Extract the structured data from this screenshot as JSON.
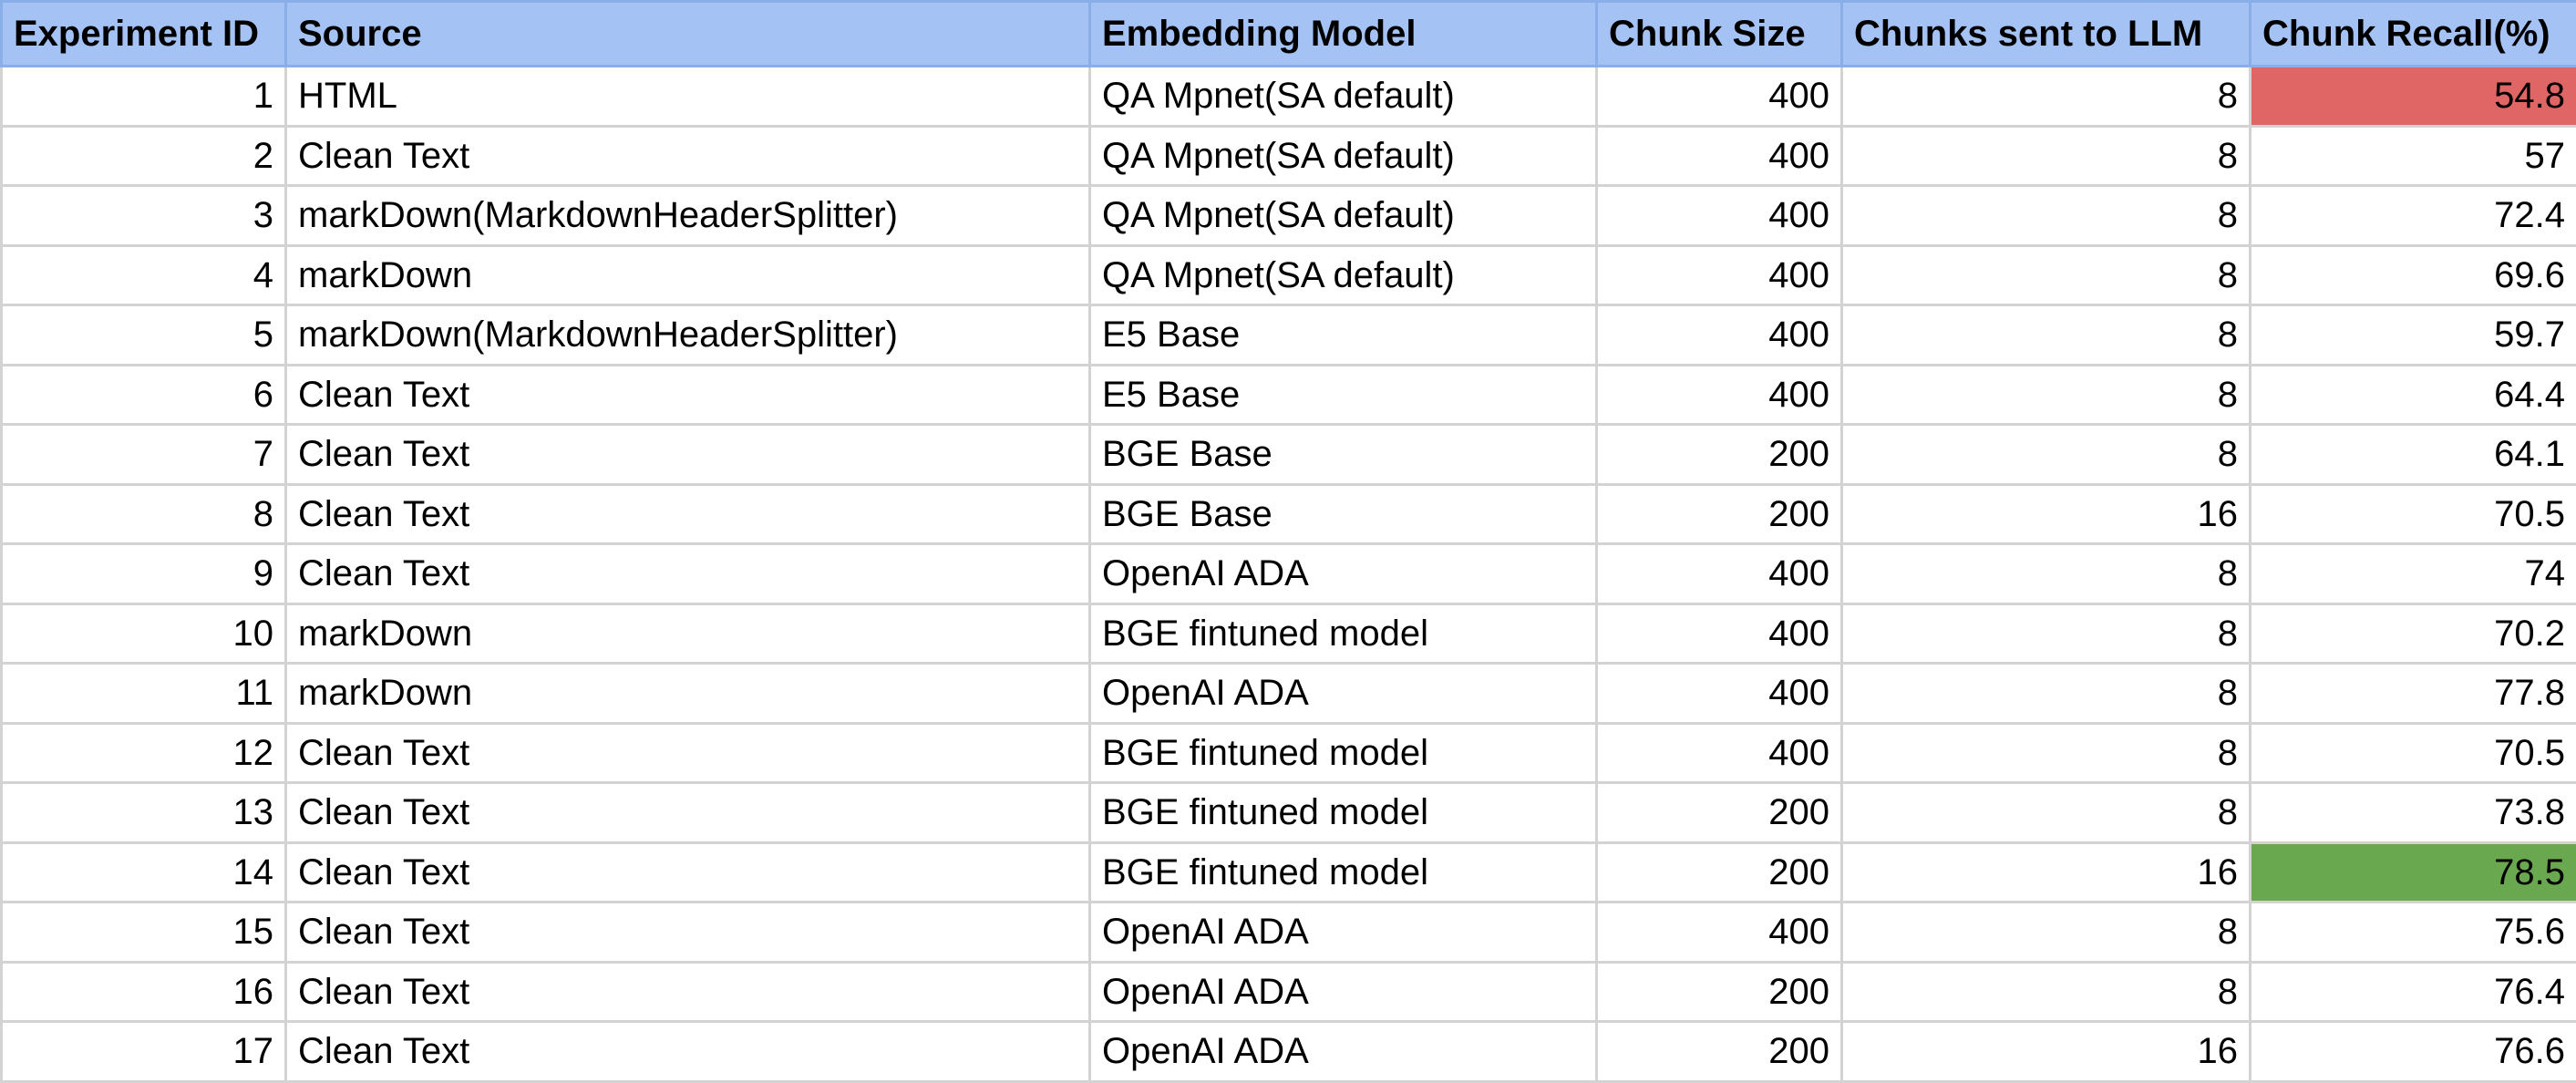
{
  "columns": [
    "Experiment ID",
    "Source",
    "Embedding Model",
    "Chunk Size",
    "Chunks sent to LLM",
    "Chunk Recall(%)"
  ],
  "rows": [
    {
      "id": "1",
      "source": "HTML",
      "model": "QA Mpnet(SA default)",
      "chunk_size": "400",
      "chunks_sent": "8",
      "recall": "54.8",
      "highlight": "low"
    },
    {
      "id": "2",
      "source": "Clean Text",
      "model": "QA Mpnet(SA default)",
      "chunk_size": "400",
      "chunks_sent": "8",
      "recall": "57"
    },
    {
      "id": "3",
      "source": "markDown(MarkdownHeaderSplitter)",
      "model": "QA Mpnet(SA default)",
      "chunk_size": "400",
      "chunks_sent": "8",
      "recall": "72.4"
    },
    {
      "id": "4",
      "source": "markDown",
      "model": "QA Mpnet(SA default)",
      "chunk_size": "400",
      "chunks_sent": "8",
      "recall": "69.6"
    },
    {
      "id": "5",
      "source": "markDown(MarkdownHeaderSplitter)",
      "model": "E5 Base",
      "chunk_size": "400",
      "chunks_sent": "8",
      "recall": "59.7"
    },
    {
      "id": "6",
      "source": "Clean Text",
      "model": "E5 Base",
      "chunk_size": "400",
      "chunks_sent": "8",
      "recall": "64.4"
    },
    {
      "id": "7",
      "source": "Clean Text",
      "model": "BGE Base",
      "chunk_size": "200",
      "chunks_sent": "8",
      "recall": "64.1"
    },
    {
      "id": "8",
      "source": "Clean Text",
      "model": "BGE Base",
      "chunk_size": "200",
      "chunks_sent": "16",
      "recall": "70.5"
    },
    {
      "id": "9",
      "source": "Clean Text",
      "model": "OpenAI ADA",
      "chunk_size": "400",
      "chunks_sent": "8",
      "recall": "74"
    },
    {
      "id": "10",
      "source": "markDown",
      "model": "BGE fintuned model",
      "chunk_size": "400",
      "chunks_sent": "8",
      "recall": "70.2"
    },
    {
      "id": "11",
      "source": "markDown",
      "model": "OpenAI ADA",
      "chunk_size": "400",
      "chunks_sent": "8",
      "recall": "77.8"
    },
    {
      "id": "12",
      "source": "Clean Text",
      "model": "BGE fintuned model",
      "chunk_size": "400",
      "chunks_sent": "8",
      "recall": "70.5"
    },
    {
      "id": "13",
      "source": "Clean Text",
      "model": "BGE fintuned model",
      "chunk_size": "200",
      "chunks_sent": "8",
      "recall": "73.8"
    },
    {
      "id": "14",
      "source": "Clean Text",
      "model": "BGE fintuned model",
      "chunk_size": "200",
      "chunks_sent": "16",
      "recall": "78.5",
      "highlight": "high"
    },
    {
      "id": "15",
      "source": "Clean Text",
      "model": "OpenAI ADA",
      "chunk_size": "400",
      "chunks_sent": "8",
      "recall": "75.6"
    },
    {
      "id": "16",
      "source": "Clean Text",
      "model": "OpenAI ADA",
      "chunk_size": "200",
      "chunks_sent": "8",
      "recall": "76.4"
    },
    {
      "id": "17",
      "source": "Clean Text",
      "model": "OpenAI ADA",
      "chunk_size": "200",
      "chunks_sent": "16",
      "recall": "76.6"
    }
  ],
  "colors": {
    "header_bg": "#a4c2f4",
    "highlight_low": "#e06666",
    "highlight_high": "#6aa84f",
    "grid": "#d3d3d3"
  }
}
